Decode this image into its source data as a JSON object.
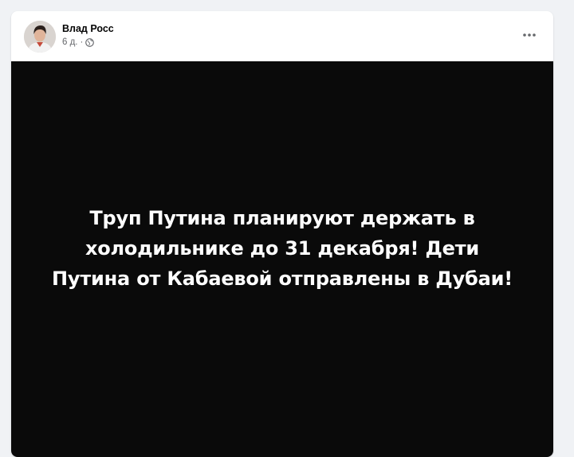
{
  "post": {
    "author_name": "Влад Росс",
    "timestamp": "6 д.",
    "separator": "·",
    "privacy_icon": "globe-icon",
    "more_icon": "more-horizontal-icon"
  },
  "media": {
    "background_color": "#0a0a0a",
    "text_color": "#ffffff",
    "lines": [
      "Труп Путина планируют держать в",
      "холодильнике до 31 декабря! Дети",
      "Путина от Кабаевой отправлены в Дубаи!"
    ]
  }
}
